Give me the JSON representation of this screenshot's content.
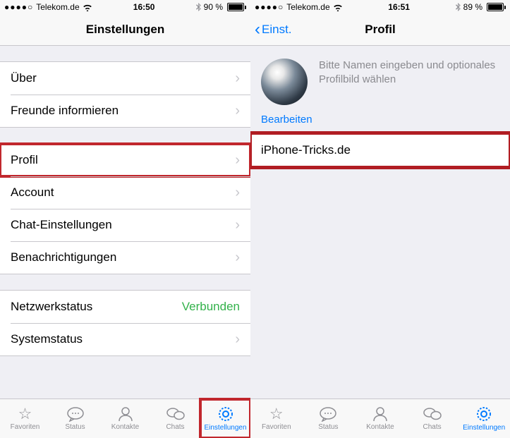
{
  "left": {
    "status": {
      "carrier": "Telekom.de",
      "time": "16:50",
      "battery_pct": "90 %"
    },
    "nav": {
      "title": "Einstellungen"
    },
    "groups": [
      {
        "rows": [
          {
            "label": "Über",
            "chevron": true
          },
          {
            "label": "Freunde informieren",
            "chevron": true
          }
        ]
      },
      {
        "rows": [
          {
            "label": "Profil",
            "chevron": true
          },
          {
            "label": "Account",
            "chevron": true
          },
          {
            "label": "Chat-Einstellungen",
            "chevron": true
          },
          {
            "label": "Benachrichtigungen",
            "chevron": true
          }
        ]
      },
      {
        "rows": [
          {
            "label": "Netzwerkstatus",
            "value": "Verbunden"
          },
          {
            "label": "Systemstatus",
            "chevron": true
          }
        ]
      }
    ],
    "tabs": [
      {
        "label": "Favoriten"
      },
      {
        "label": "Status"
      },
      {
        "label": "Kontakte"
      },
      {
        "label": "Chats"
      },
      {
        "label": "Einstellungen"
      }
    ]
  },
  "right": {
    "status": {
      "carrier": "Telekom.de",
      "time": "16:51",
      "battery_pct": "89 %"
    },
    "nav": {
      "back": "Einst.",
      "title": "Profil"
    },
    "profile": {
      "hint": "Bitte Namen eingeben und optionales Profilbild wählen",
      "edit": "Bearbeiten",
      "name": "iPhone-Tricks.de"
    },
    "tabs": [
      {
        "label": "Favoriten"
      },
      {
        "label": "Status"
      },
      {
        "label": "Kontakte"
      },
      {
        "label": "Chats"
      },
      {
        "label": "Einstellungen"
      }
    ]
  }
}
